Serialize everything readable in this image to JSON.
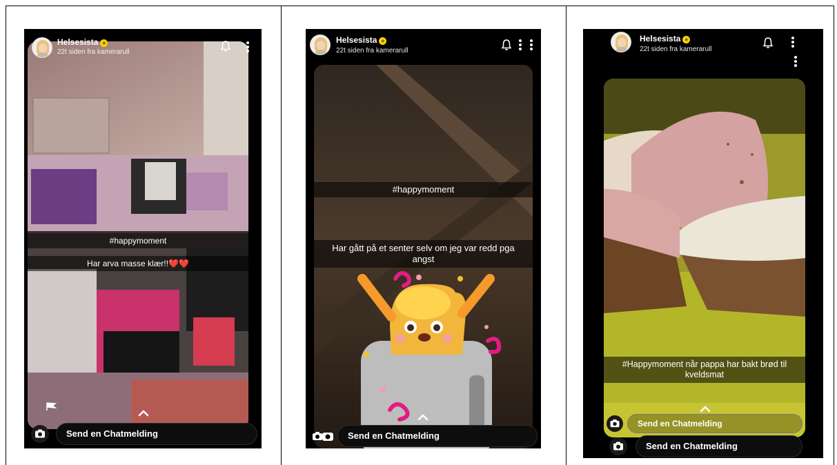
{
  "screens": [
    {
      "username": "Helsesista",
      "timestamp": "22t siden fra kamerarull",
      "captions": [
        "#happymoment",
        "Har arva masse klær!!❤️❤️"
      ],
      "chat_placeholder": "Send en Chatmelding"
    },
    {
      "username": "Helsesista",
      "timestamp": "22t siden fra kamerarull",
      "captions": [
        "#happymoment",
        "Har gått på et senter selv om jeg var redd pga angst"
      ],
      "chat_placeholder": "Send en Chatmelding"
    },
    {
      "username": "Helsesista",
      "timestamp": "22t siden fra kamerarull",
      "captions": [
        "#Happymoment når pappa har bakt brød til kveldsmat"
      ],
      "chat_placeholder": "Send en Chatmelding",
      "chat_placeholder_inner": "Send en Chatmelding"
    }
  ],
  "icons": {
    "verified": "star-badge-icon",
    "notify": "bell-icon",
    "more": "more-vertical-icon",
    "camera": "camera-icon",
    "swipe_up": "chevron-up-icon"
  },
  "colors": {
    "badge": "#ffd400",
    "background": "#000000"
  }
}
